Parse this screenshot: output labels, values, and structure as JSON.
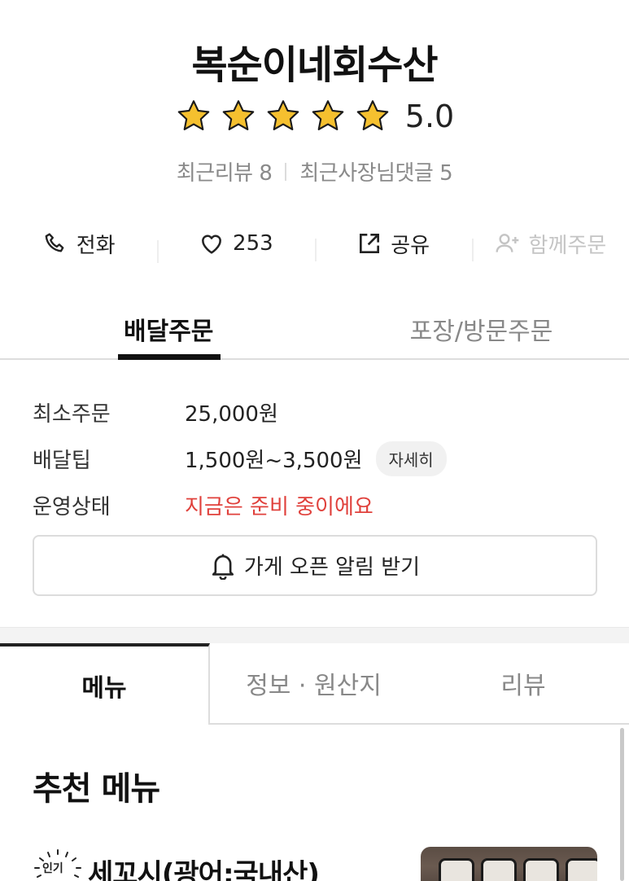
{
  "store": {
    "name": "복순이네회수산",
    "rating": "5.0",
    "stars": 5,
    "recent_reviews": "최근리뷰 8",
    "recent_owner_replies": "최근사장님댓글 5"
  },
  "actions": {
    "call": "전화",
    "like_count": "253",
    "share": "공유",
    "group_order": "함께주문"
  },
  "order_tabs": {
    "delivery": "배달주문",
    "pickup": "포장/방문주문"
  },
  "info": {
    "min_order_label": "최소주문",
    "min_order_value": "25,000원",
    "delivery_tip_label": "배달팁",
    "delivery_tip_value": "1,500원~3,500원",
    "detail_chip": "자세히",
    "status_label": "운영상태",
    "status_value": "지금은 준비 중이에요"
  },
  "alarm_button": "가게 오픈 알림 받기",
  "menu_tabs": {
    "menu": "메뉴",
    "info": "정보 · 원산지",
    "reviews": "리뷰"
  },
  "recommended": {
    "title": "추천 메뉴",
    "items": [
      {
        "badge": "인기",
        "name": "세꼬시(광어:국내산)"
      }
    ]
  },
  "colors": {
    "star": "#f5c02f",
    "status_red": "#e0413c",
    "active_tab": "#111111"
  }
}
